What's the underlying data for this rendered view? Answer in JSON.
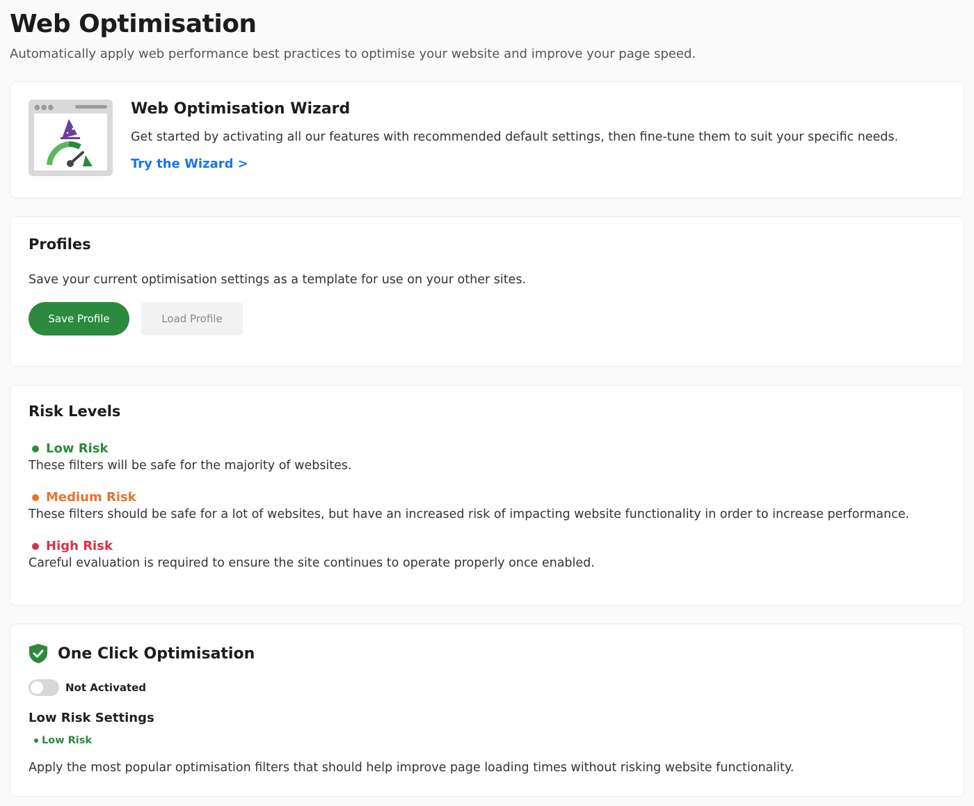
{
  "header": {
    "title": "Web Optimisation",
    "subtitle": "Automatically apply web performance best practices to optimise your website and improve your page speed."
  },
  "wizard": {
    "title": "Web Optimisation Wizard",
    "description": "Get started by activating all our features with recommended default settings, then fine-tune them to suit your specific needs.",
    "link_label": "Try the Wizard >",
    "illustration_icon": "browser-wizard-speedometer-icon"
  },
  "profiles": {
    "heading": "Profiles",
    "description": "Save your current optimisation settings as a template for use on your other sites.",
    "save_label": "Save Profile",
    "load_label": "Load Profile"
  },
  "risk_levels": {
    "heading": "Risk Levels",
    "items": [
      {
        "label": "Low Risk",
        "description": "These filters will be safe for the majority of websites.",
        "color": "#2b8a3e"
      },
      {
        "label": "Medium Risk",
        "description": "These filters should be safe for a lot of websites, but have an increased risk of impacting website functionality in order to increase performance.",
        "color": "#e8742a"
      },
      {
        "label": "High Risk",
        "description": "Careful evaluation is required to ensure the site continues to operate properly once enabled.",
        "color": "#d63447"
      }
    ]
  },
  "one_click": {
    "title": "One Click Optimisation",
    "icon": "shield-check-icon",
    "toggle_label": "Not Activated",
    "toggle_on": false,
    "settings_title": "Low Risk Settings",
    "settings_badge": "Low Risk",
    "settings_description": "Apply the most popular optimisation filters that should help improve page loading times without risking website functionality."
  },
  "colors": {
    "accent_green": "#2b8a3e",
    "link_blue": "#1a73e8"
  }
}
